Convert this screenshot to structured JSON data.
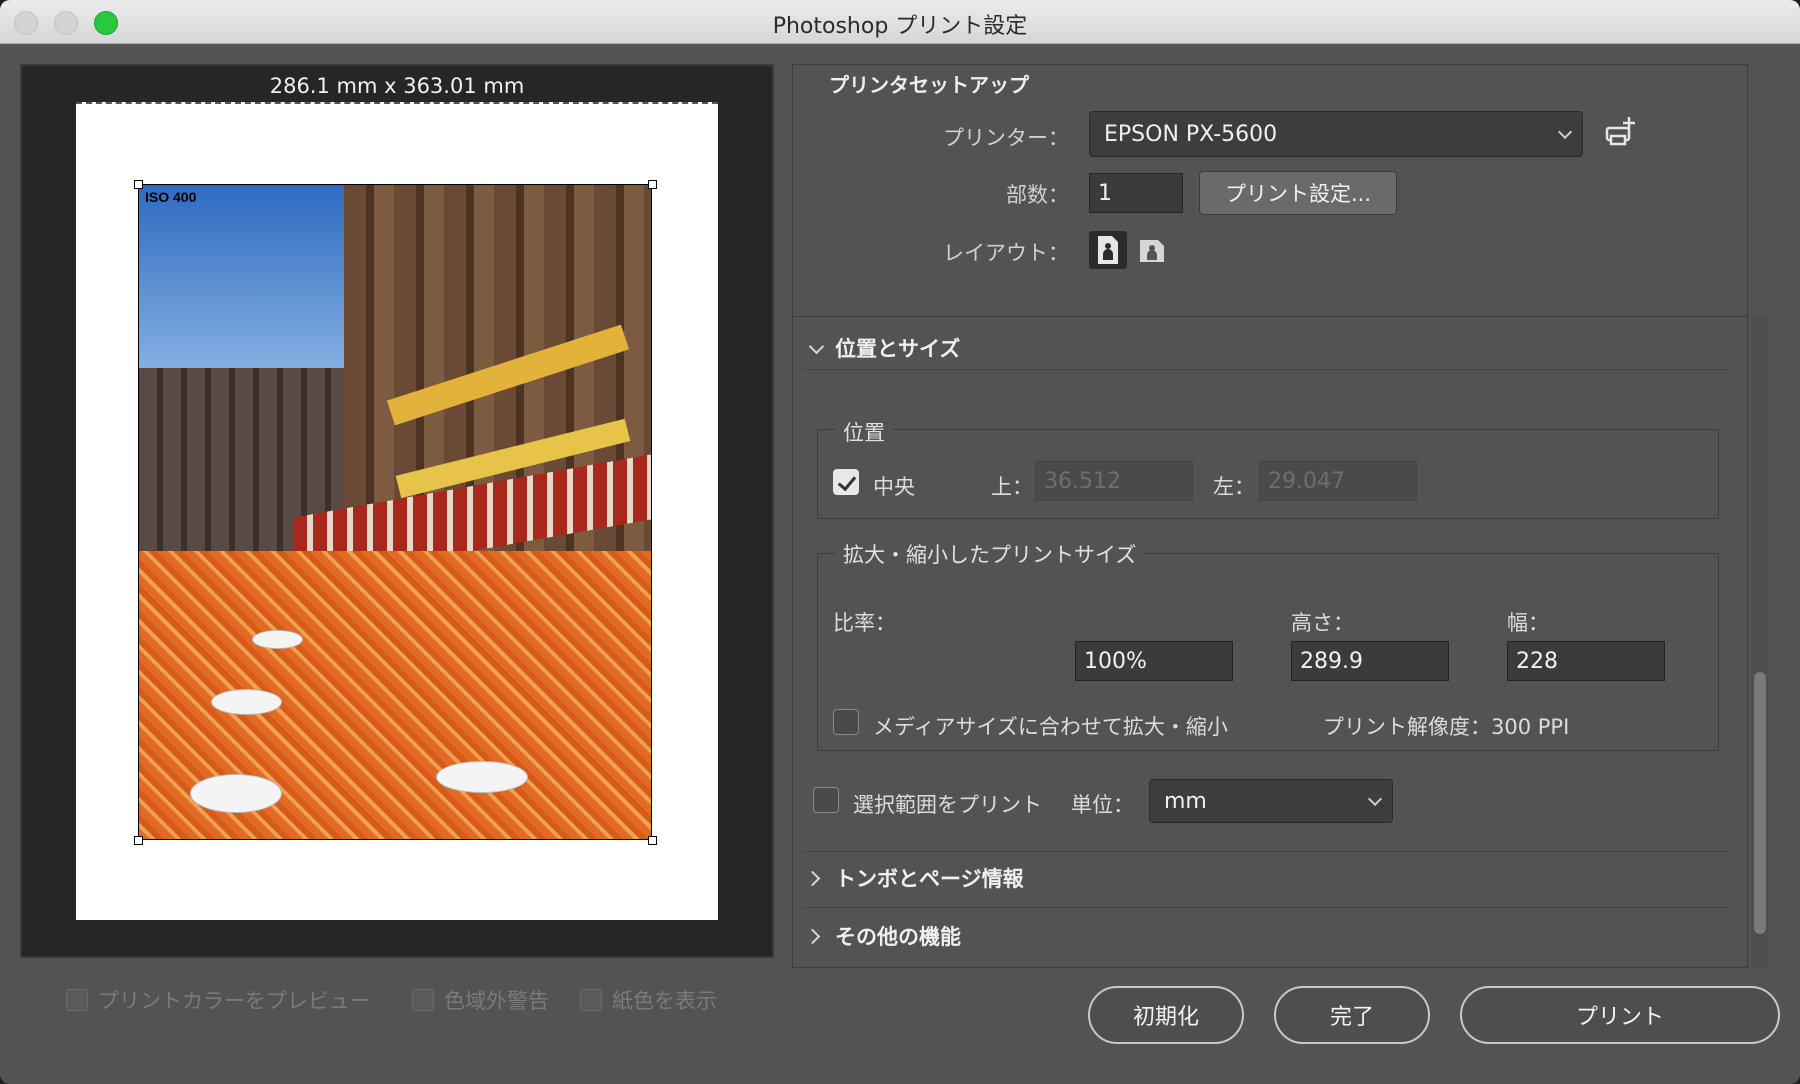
{
  "window": {
    "title": "Photoshop プリント設定"
  },
  "preview": {
    "dimensions": "286.1 mm x 363.01 mm",
    "image_label": "ISO 400"
  },
  "preview_options": [
    {
      "label": "プリントカラーをプレビュー",
      "checked": false,
      "enabled": false
    },
    {
      "label": "色域外警告",
      "checked": false,
      "enabled": false
    },
    {
      "label": "紙色を表示",
      "checked": false,
      "enabled": false
    }
  ],
  "printer_setup": {
    "section_title": "プリンタセットアップ",
    "printer_label": "プリンター：",
    "printer_value": "EPSON PX-5600",
    "copies_label": "部数：",
    "copies_value": "1",
    "print_settings_button": "プリント設定...",
    "layout_label": "レイアウト："
  },
  "position_size": {
    "section_title": "位置とサイズ",
    "expanded": true,
    "position_group": "位置",
    "center_label": "中央",
    "center_checked": true,
    "top_label": "上：",
    "top_value": "36.512",
    "left_label": "左：",
    "left_value": "29.047",
    "scaled_group": "拡大・縮小したプリントサイズ",
    "scale_label": "比率：",
    "scale_value": "100%",
    "height_label": "高さ：",
    "height_value": "289.9",
    "width_label": "幅：",
    "width_value": "228",
    "fit_media_label": "メディアサイズに合わせて拡大・縮小",
    "fit_media_checked": false,
    "resolution_text": "プリント解像度：300 PPI",
    "print_selection_label": "選択範囲をプリント",
    "print_selection_checked": false,
    "units_label": "単位：",
    "units_value": "mm"
  },
  "collapsed_sections": [
    {
      "label": "トンボとページ情報"
    },
    {
      "label": "その他の機能"
    }
  ],
  "buttons": {
    "reset": "初期化",
    "done": "完了",
    "print": "プリント"
  }
}
